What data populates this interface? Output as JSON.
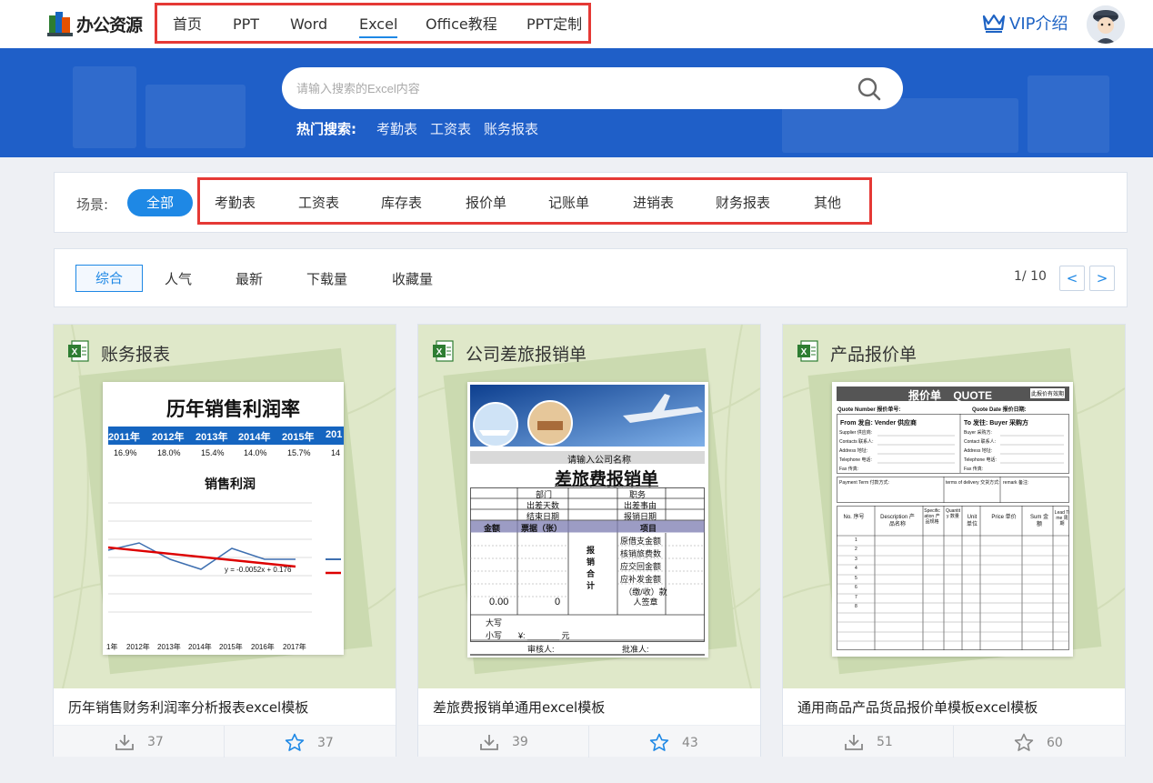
{
  "header": {
    "logo_text": "办公资源",
    "nav": [
      "首页",
      "PPT",
      "Word",
      "Excel",
      "Office教程",
      "PPT定制"
    ],
    "active_nav": "Excel",
    "vip_label": "VIP介绍"
  },
  "search": {
    "placeholder": "请输入搜索的Excel内容",
    "hot_label": "热门搜索:",
    "hot_items": [
      "考勤表",
      "工资表",
      "账务报表"
    ]
  },
  "filter": {
    "scene_label": "场景:",
    "all_label": "全部",
    "categories": [
      "考勤表",
      "工资表",
      "库存表",
      "报价单",
      "记账单",
      "进销表",
      "财务报表",
      "其他"
    ]
  },
  "sort": {
    "options": [
      "综合",
      "人气",
      "最新",
      "下载量",
      "收藏量"
    ],
    "active": "综合",
    "page_indicator": "1/ 10",
    "prev_label": "<",
    "next_label": ">"
  },
  "cards": [
    {
      "category": "账务报表",
      "title": "历年销售财务利润率分析报表excel模板",
      "downloads": "37",
      "favorites": "37",
      "preview": {
        "heading": "历年销售利润率",
        "years": [
          "2011年",
          "2012年",
          "2013年",
          "2014年",
          "2015年",
          "201"
        ],
        "rates": [
          "16.9%",
          "18.0%",
          "15.4%",
          "14.0%",
          "15.7%",
          "14"
        ],
        "chart_title": "销售利润",
        "equation": "y = -0.0052x + 0.176",
        "axis_years": [
          "1年",
          "2012年",
          "2013年",
          "2014年",
          "2015年",
          "2016年",
          "2017年"
        ]
      }
    },
    {
      "category": "公司差旅报销单",
      "title": "差旅费报销单通用excel模板",
      "downloads": "39",
      "favorites": "43",
      "preview": {
        "company": "请输入公司名称",
        "heading": "差旅费报销单",
        "row1": [
          "部门",
          "职务"
        ],
        "row2": [
          "出差天数",
          "出差事由"
        ],
        "row3": [
          "结束日期",
          "报销日期"
        ],
        "cols": [
          "金额",
          "票据（张）",
          "项目"
        ],
        "items": [
          "原借支金额",
          "核销旅费数",
          "应交回金额",
          "应补发金额"
        ],
        "side": "报销合计",
        "amount": "0.00",
        "count": "0",
        "signer": "（缴/收）款人签章",
        "daxie": "大写",
        "xiaoxie": "小写",
        "yuan_line": "¥: _______  元",
        "auditor": "审核人:",
        "approver": "批准人:"
      }
    },
    {
      "category": "产品报价单",
      "title": "通用商品产品货品报价单模板excel模板",
      "downloads": "51",
      "favorites": "60",
      "preview": {
        "heading": "报价单    QUOTE",
        "tag": "此报价有效期",
        "quote_number": "Quote Number 报价单号:",
        "quote_date": "Quote Date 报价日期:",
        "from": "From 发自: Vender 供应商",
        "to": "To 发往: Buyer 采购方",
        "left_fields": [
          "Supplier 供应商:",
          "Contacts 联系人:",
          "Address 地址:",
          "Telephone 电话:",
          "Fax 传真:"
        ],
        "right_fields": [
          "Buyer 采购方:",
          "Contact 联系人:",
          "Address 地址:",
          "Telephone 电话:",
          "Fax 传真:"
        ],
        "payment": "Payment Term 付款方式:",
        "delivery": "terms of delivery 交货方式:",
        "remark": "remark 备注:",
        "cols": [
          "No. 序号",
          "Description 产品名称",
          "Specification 产品规格",
          "Quantity 数量",
          "Unit 单位",
          "Price 单价",
          "Sum 金额",
          "Lead Time 周期"
        ],
        "rows": [
          "1",
          "2",
          "3",
          "4",
          "5",
          "6",
          "7",
          "8"
        ]
      }
    }
  ],
  "colors": {
    "accent": "#1e88e5",
    "banner": "#1f5fc8",
    "highlight_border": "#e53935",
    "thumb_bg": "#dfe8c9"
  }
}
